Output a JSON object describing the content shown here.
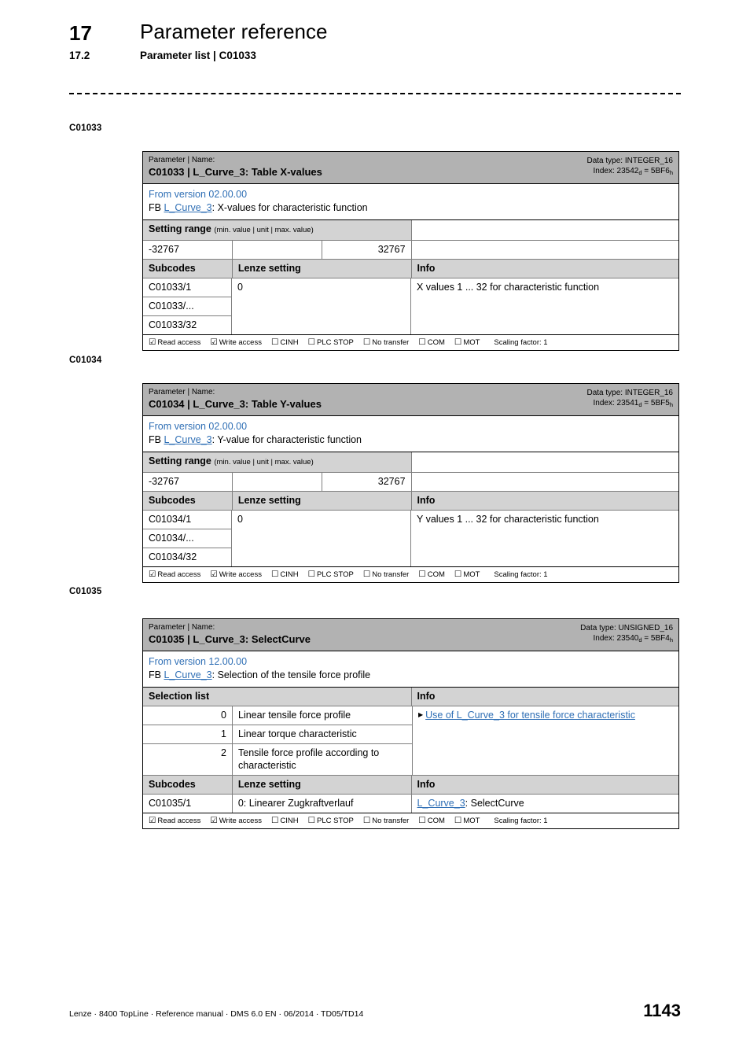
{
  "header": {
    "chapter_number": "17",
    "chapter_title": "Parameter reference",
    "section_number": "17.2",
    "section_title": "Parameter list | C01033"
  },
  "footer": {
    "text": "Lenze · 8400 TopLine · Reference manual · DMS 6.0 EN · 06/2014 · TD05/TD14",
    "page_number": "1143"
  },
  "access_labels": {
    "read": "Read access",
    "write": "Write access",
    "cinh": "CINH",
    "plc_stop": "PLC STOP",
    "no_transfer": "No transfer",
    "com": "COM",
    "mot": "MOT",
    "scaling": "Scaling factor: 1",
    "checked_glyph": "☑",
    "unchecked_glyph": "☐"
  },
  "common_labels": {
    "parameter_name_kicker": "Parameter | Name:",
    "setting_range": "Setting range",
    "setting_range_sub": "(min. value | unit | max. value)",
    "subcodes": "Subcodes",
    "lenze_setting": "Lenze setting",
    "info": "Info",
    "selection_list": "Selection list",
    "fb_prefix": "FB"
  },
  "colors": {
    "title_band": "#b2b2b2",
    "section_head": "#d3d3d3",
    "link": "#2f6fb5"
  },
  "blocks": [
    {
      "margin_label": "C01033",
      "title_name": "C01033 | L_Curve_3: Table X-values",
      "data_type": "Data type: INTEGER_16",
      "index_label": "Index: 23542",
      "index_dec_sub": "d",
      "index_eq": " = 5BF6",
      "index_hex_sub": "h",
      "version": "From version 02.00.00",
      "fb_link": "L_Curve_3",
      "fb_desc": ": X-values for characteristic function",
      "setting_range": {
        "min": "-32767",
        "unit": "",
        "max": "32767"
      },
      "subcodes": [
        "C01033/1",
        "C01033/...",
        "C01033/32"
      ],
      "lenze_setting": "0",
      "info": "X values 1 ... 32 for characteristic function"
    },
    {
      "margin_label": "C01034",
      "title_name": "C01034 | L_Curve_3: Table Y-values",
      "data_type": "Data type: INTEGER_16",
      "index_label": "Index: 23541",
      "index_dec_sub": "d",
      "index_eq": " = 5BF5",
      "index_hex_sub": "h",
      "version": "From version 02.00.00",
      "fb_link": "L_Curve_3",
      "fb_desc": ": Y-value for characteristic function",
      "setting_range": {
        "min": "-32767",
        "unit": "",
        "max": "32767"
      },
      "subcodes": [
        "C01034/1",
        "C01034/...",
        "C01034/32"
      ],
      "lenze_setting": "0",
      "info": "Y values 1 ... 32 for characteristic function"
    }
  ],
  "block3": {
    "margin_label": "C01035",
    "title_name": "C01035 | L_Curve_3: SelectCurve",
    "data_type": "Data type: UNSIGNED_16",
    "index_label": "Index: 23540",
    "index_dec_sub": "d",
    "index_eq": " = 5BF4",
    "index_hex_sub": "h",
    "version": "From version 12.00.00",
    "fb_link": "L_Curve_3",
    "fb_desc": ": Selection of the tensile force profile",
    "selection_list": [
      {
        "value": "0",
        "text": "Linear tensile force profile"
      },
      {
        "value": "1",
        "text": "Linear torque characteristic"
      },
      {
        "value": "2",
        "text": "Tensile force profile according to characteristic"
      }
    ],
    "selection_info_link": "Use of L_Curve_3 for tensile force characteristic",
    "subcode": "C01035/1",
    "lenze_setting": "0: Linearer Zugkraftverlauf",
    "info_link": "L_Curve_3",
    "info_rest": ": SelectCurve"
  }
}
